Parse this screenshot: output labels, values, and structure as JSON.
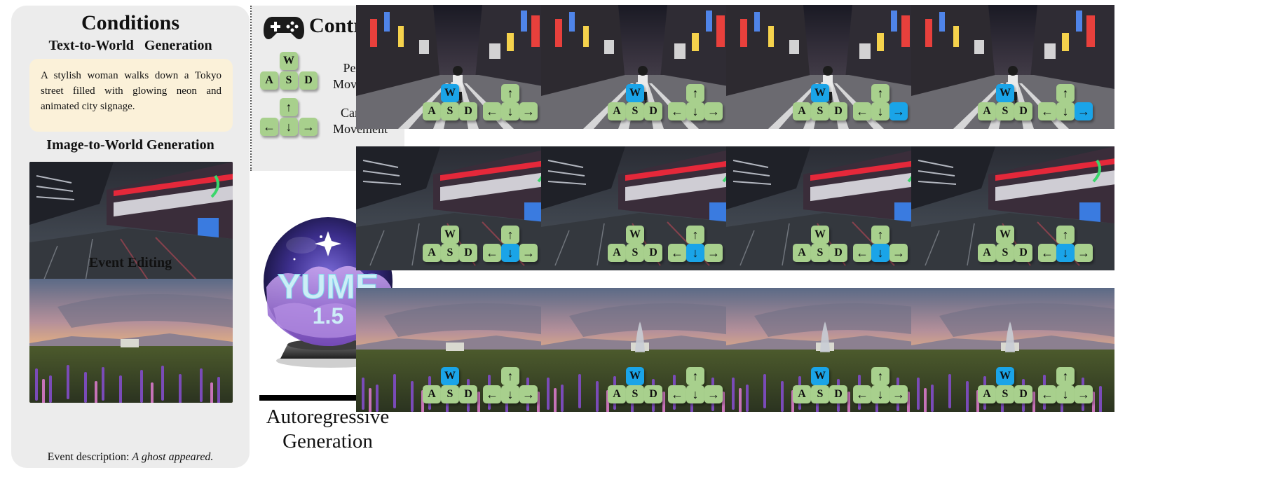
{
  "conditions": {
    "title": "Conditions",
    "t2w_title": "Text-to-World   Generation",
    "prompt": "A stylish woman walks down a Tokyo street filled with glowing neon and animated city signage.",
    "i2w_title": "Image-to-World Generation",
    "event_title": "Event Editing",
    "event_desc_label": "Event description:",
    "event_desc_text": "A ghost appeared."
  },
  "controls": {
    "title": "Controls",
    "person_label": "Person Movement",
    "camera_label": "Camera Movement",
    "keys": {
      "w": "W",
      "a": "A",
      "s": "S",
      "d": "D",
      "up": "↑",
      "down": "↓",
      "left": "←",
      "right": "→"
    }
  },
  "logo": {
    "line1": "YUME",
    "line2": "1.5"
  },
  "autoregressive_label": "Autoregressive Generation",
  "colors": {
    "key_idle": "#a8d08d",
    "key_active": "#1aa4e8",
    "panel": "#ececec",
    "prompt_bg": "#fbf1d9"
  },
  "rows": [
    {
      "scene": "tokyo-street",
      "frames": [
        {
          "active": [
            "w"
          ]
        },
        {
          "active": [
            "w"
          ]
        },
        {
          "active": [
            "w",
            "right"
          ]
        },
        {
          "active": [
            "w",
            "right"
          ]
        }
      ]
    },
    {
      "scene": "arcade-street",
      "frames": [
        {
          "active": [
            "down"
          ]
        },
        {
          "active": [
            "down"
          ]
        },
        {
          "active": [
            "down"
          ]
        },
        {
          "active": [
            "down"
          ]
        }
      ]
    },
    {
      "scene": "lupine-field",
      "frames": [
        {
          "active": [
            "w"
          ],
          "ghost": false
        },
        {
          "active": [
            "w"
          ],
          "ghost": true
        },
        {
          "active": [
            "w"
          ],
          "ghost": true
        },
        {
          "active": [
            "w"
          ],
          "ghost": true
        }
      ]
    }
  ]
}
